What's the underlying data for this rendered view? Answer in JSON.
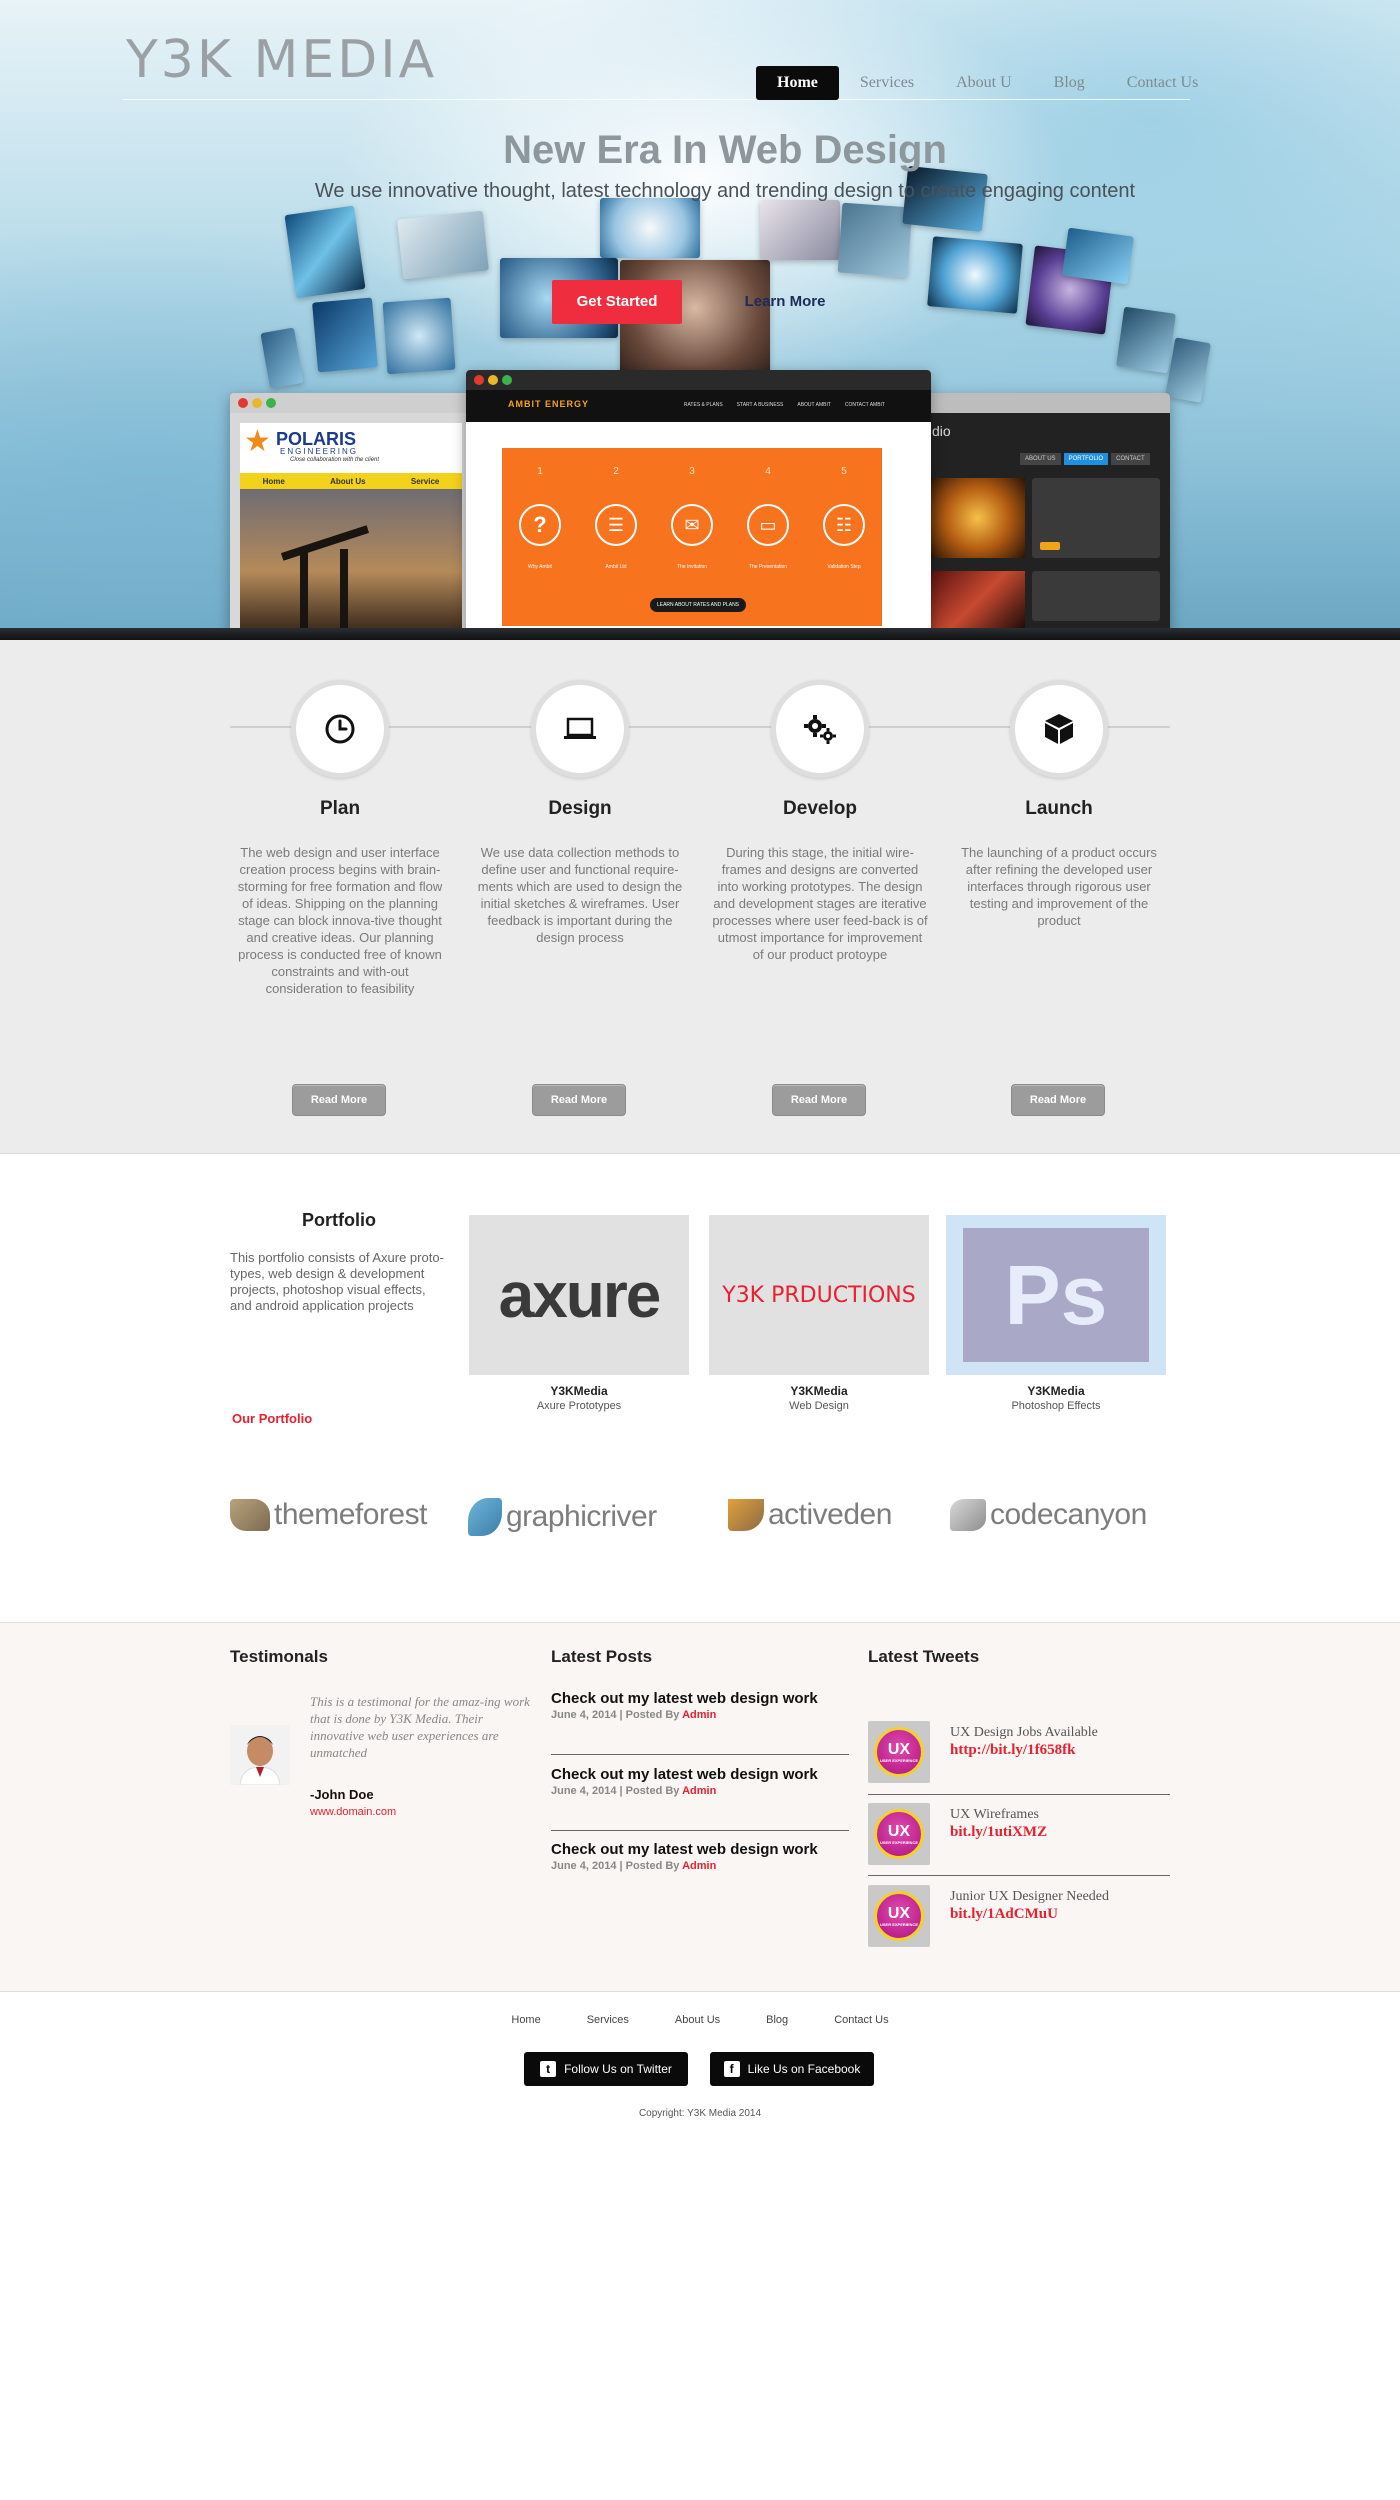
{
  "brand": {
    "logo": "Y3K MEDIA"
  },
  "nav": [
    "Home",
    "Services",
    "About U",
    "Blog",
    "Contact Us"
  ],
  "hero": {
    "title": "New Era In Web Design",
    "subtitle": "We use innovative thought, latest technology and trending design to create engaging content",
    "cta_primary": "Get Started",
    "cta_secondary": "Learn More"
  },
  "mockups": {
    "left": {
      "brand": "POLARIS",
      "brand_sub": "ENGINEERING",
      "tagline": "Close collaboration with the client",
      "menu": [
        "Home",
        "About Us",
        "Service"
      ]
    },
    "center": {
      "brand": "AMBIT ENERGY",
      "menu": [
        "RATES & PLANS",
        "START A BUSINESS",
        "ABOUT AMBIT",
        "CONTACT AMBIT"
      ],
      "steps": [
        "1",
        "2",
        "3",
        "4",
        "5"
      ],
      "step_labels": [
        "Why Ambit",
        "Ambit Ltd",
        "The Invitation",
        "The Presentation",
        "Validation Step"
      ],
      "cta": "LEARN ABOUT RATES AND PLANS"
    },
    "right": {
      "title": "dio",
      "tabs": [
        "ABOUT US",
        "PORTFOLIO",
        "CONTACT"
      ]
    }
  },
  "process": [
    {
      "title": "Plan",
      "icon": "clock-icon",
      "text": "The web design and user interface creation process begins with brain-storming for free formation and flow of ideas.  Shipping on the planning stage can block innova-tive thought and creative ideas. Our planning process is conducted free of known constraints and with-out consideration to feasibility",
      "button": "Read More"
    },
    {
      "title": "Design",
      "icon": "laptop-icon",
      "text": "We use data collection methods to define user  and functional require-ments which are used to design the initial sketches & wireframes.  User feedback is important during the design process",
      "button": "Read More"
    },
    {
      "title": "Develop",
      "icon": "gears-icon",
      "text": "During this stage, the initial wire-frames and designs are converted into working prototypes.  The design and development stages are iterative processes where user feed-back is of utmost importance for improvement of our product protoype",
      "button": "Read More"
    },
    {
      "title": "Launch",
      "icon": "cube-icon",
      "text": "The launching of a product occurs after refining the developed user interfaces through rigorous user testing and improvement of the product",
      "button": "Read More"
    }
  ],
  "portfolio": {
    "title": "Portfolio",
    "description": "This portfolio consists of Axure proto-types, web design & development projects, photoshop visual effects, and android application projects",
    "link": "Our Portfolio",
    "items": [
      {
        "thumb_text": "axure",
        "caption": "Y3KMedia",
        "subcaption": "Axure Prototypes"
      },
      {
        "thumb_text": "Y3K PRDUCTIONS",
        "caption": "Y3KMedia",
        "subcaption": "Web Design"
      },
      {
        "thumb_text": "Ps",
        "caption": "Y3KMedia",
        "subcaption": "Photoshop Effects"
      }
    ]
  },
  "marketplaces": [
    "themeforest",
    "graphicriver",
    "activeden",
    "codecanyon"
  ],
  "testimonials": {
    "title": "Testimonals",
    "quote": "This is a testimonal  for  the amaz-ing work that is done by Y3K Media.  Their innovative web user experiences are unmatched",
    "author": "-John Doe",
    "url": "www.domain.com"
  },
  "latest_posts": {
    "title": "Latest Posts",
    "posts": [
      {
        "title": "Check out my latest web design work",
        "date": "June 4, 2014",
        "sep": " | Posted By ",
        "author": "Admin"
      },
      {
        "title": "Check out my latest web design work",
        "date": "June 4, 2014",
        "sep": " | Posted By ",
        "author": "Admin"
      },
      {
        "title": "Check out my latest web design work",
        "date": "June 4, 2014",
        "sep": " | Posted By ",
        "author": "Admin"
      }
    ]
  },
  "latest_tweets": {
    "title": "Latest Tweets",
    "badge": "UX",
    "badge_sub": "USER EXPERIENCE",
    "tweets": [
      {
        "text": "UX Design Jobs Available",
        "link": "http://bit.ly/1f658fk"
      },
      {
        "text": "UX Wireframes",
        "link": "bit.ly/1utiXMZ"
      },
      {
        "text": "Junior UX Designer Needed",
        "link": "bit.ly/1AdCMuU"
      }
    ]
  },
  "footer": {
    "nav": [
      "Home",
      "Services",
      "About Us",
      "Blog",
      "Contact Us"
    ],
    "twitter": "Follow Us on Twitter",
    "facebook": "Like Us on Facebook",
    "copyright": "Copyright: Y3K Media 2014"
  },
  "colors": {
    "accent": "#e8202f",
    "dark": "#0b0b0b",
    "process_bg": "#ececec",
    "info_bg": "#f9f6f3",
    "mock_orange": "#f7731d"
  }
}
